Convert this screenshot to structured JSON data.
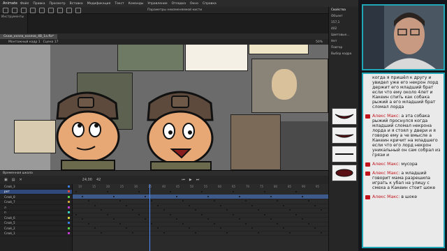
{
  "window": {
    "app_name": "Animate",
    "menu": [
      "Файл",
      "Правка",
      "Просмотр",
      "Вставка",
      "Модификация",
      "Текст",
      "Команды",
      "Управление",
      "Отладка",
      "Окно",
      "Справка"
    ],
    "tools_label": "Инструменты",
    "props_label": "Параметры неизменяемой кисти"
  },
  "document": {
    "tab_name": "Скаж_козла_козлов_4B_1a.fla*",
    "scene_label": "Монтажный кадр 1",
    "scene_name": "Сцена 17",
    "zoom": "50%"
  },
  "timeline": {
    "header": "Временная шкала",
    "fps": "24,00",
    "frame": "42",
    "layers": [
      {
        "name": "Слой_3",
        "color": "#3a7fe0"
      },
      {
        "name": "рот",
        "color": "#e04a3a",
        "selected": true
      },
      {
        "name": "Слой_8",
        "color": "#5ad04a"
      },
      {
        "name": "Слой_7",
        "color": "#d0a03a"
      },
      {
        "name": "л",
        "color": "#c03ad0"
      },
      {
        "name": "п",
        "color": "#3ad0c0"
      },
      {
        "name": "Слой_6",
        "color": "#d0d03a"
      },
      {
        "name": "Слой_5",
        "color": "#3a7fe0"
      },
      {
        "name": "Слой_2",
        "color": "#5ad04a"
      },
      {
        "name": "Слой_1",
        "color": "#c03ad0"
      }
    ],
    "frame_numbers": [
      "10",
      "15",
      "20",
      "25",
      "30",
      "35",
      "40",
      "45",
      "50",
      "55",
      "60",
      "65",
      "70",
      "75",
      "80",
      "85",
      "90",
      "95"
    ]
  },
  "right_panel": {
    "title": "Свойства",
    "rows": [
      "Объект",
      "Цветовые...",
      "Нет",
      "Повтор",
      "Выбор кадра"
    ],
    "value_x": "157,1",
    "value_y": "402"
  },
  "chat": {
    "messages": [
      {
        "type": "plain",
        "text": "когда я пришёл к другу и увидел уже его некрон лорд держит его младший брат если что ему около 4лет и Какеин спить как собака рыжий а его младший брат сломал лорда"
      },
      {
        "type": "named",
        "name": "Алекс Макс:",
        "text": " а эта собака рыжий проснулся когда младший сломал некрона лорда и я стоял у двери и я говорю ему а че вмысле а Какеин кричит на младшего если что его лорд некрон уникальный он сам собрал из грязи и"
      },
      {
        "type": "named",
        "name": "Алекс Макс:",
        "text": " мусора"
      },
      {
        "type": "named",
        "name": "Алекс Макс:",
        "text": " а младший говорит мама разрешила играть к убал на улицу с смеха а Какеин стоит шоке"
      },
      {
        "type": "named",
        "name": "Алекс Макс:",
        "text": " в шоке"
      }
    ]
  },
  "colors": {
    "accent": "#1fa7b8",
    "chat_name": "#c0141c",
    "selected_layer": "#2f4a7a"
  }
}
